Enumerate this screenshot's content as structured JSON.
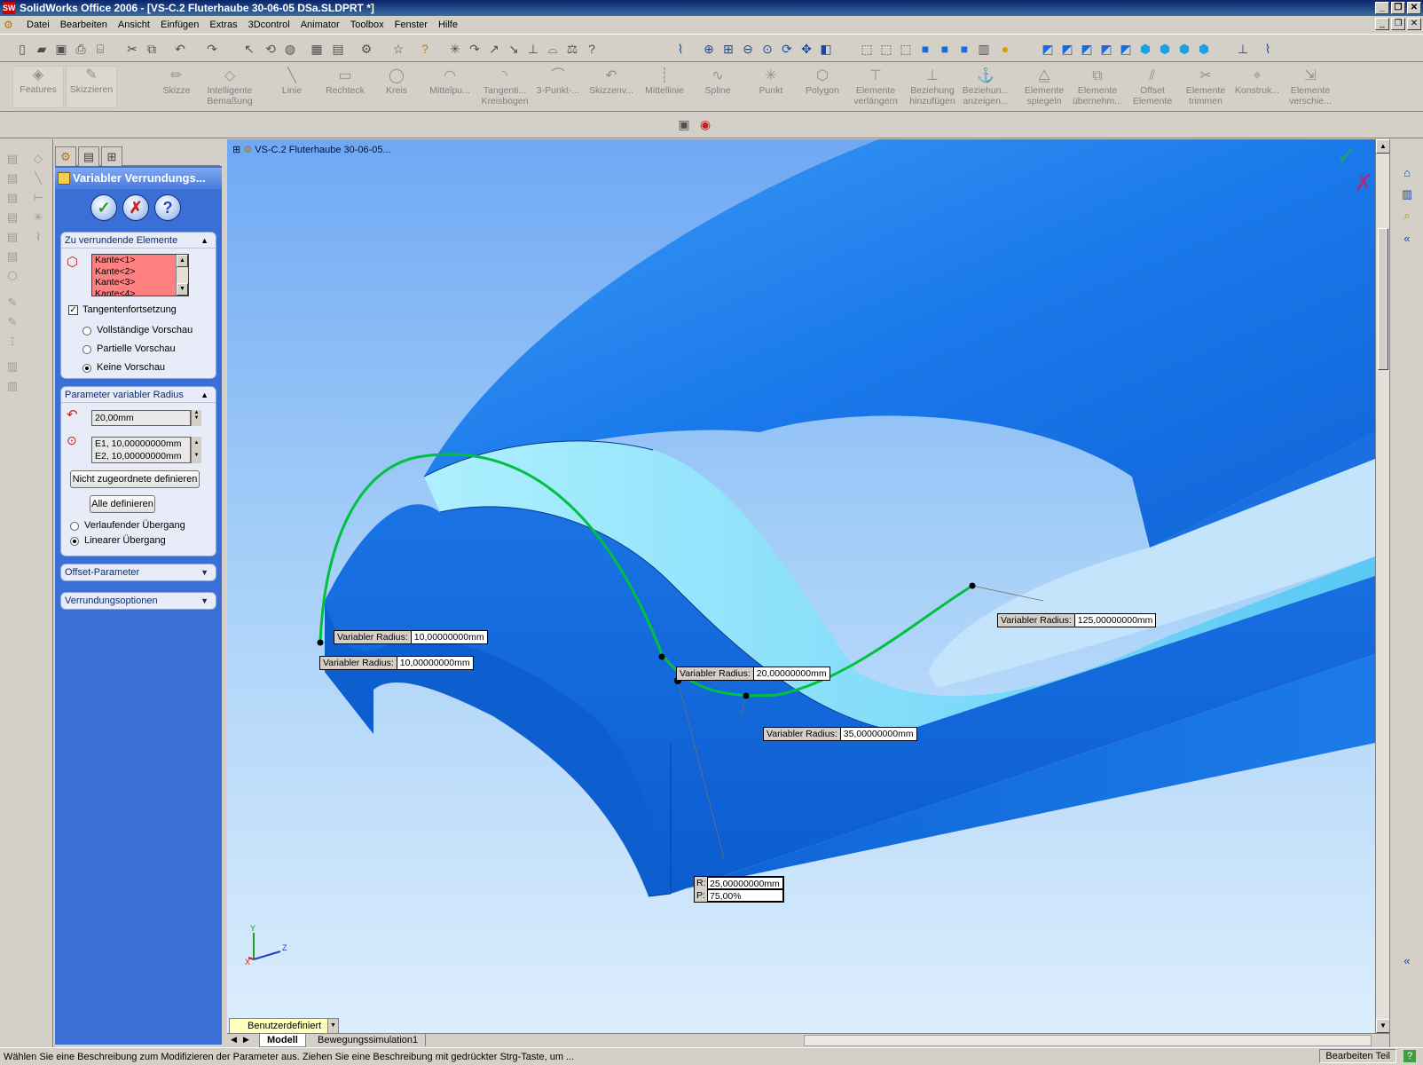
{
  "window": {
    "title": "SolidWorks Office 2006 - [VS-C.2 Fluterhaube 30-06-05 DSa.SLDPRT *]",
    "minimize": "_",
    "restore": "❐",
    "close": "✕"
  },
  "menu": {
    "items": [
      "Datei",
      "Bearbeiten",
      "Ansicht",
      "Einfügen",
      "Extras",
      "3Dcontrol",
      "Animator",
      "Toolbox",
      "Fenster",
      "Hilfe"
    ]
  },
  "commands": [
    {
      "label": "Features",
      "icon": "◈"
    },
    {
      "label": "Skizzieren",
      "icon": "✎"
    },
    {
      "label": "Skizze",
      "icon": "✏"
    },
    {
      "label": "Intelligente Bemaßung",
      "icon": "◇"
    },
    {
      "label": "Linie",
      "icon": "╲"
    },
    {
      "label": "Rechteck",
      "icon": "▭"
    },
    {
      "label": "Kreis",
      "icon": "◯"
    },
    {
      "label": "Mittelpu...",
      "icon": "◠"
    },
    {
      "label": "Tangenti... Kreisbogen",
      "icon": "◝"
    },
    {
      "label": "3-Punkt-...",
      "icon": "⌒"
    },
    {
      "label": "Skizzenv...",
      "icon": "↶"
    },
    {
      "label": "Mittellinie",
      "icon": "┊"
    },
    {
      "label": "Spline",
      "icon": "∿"
    },
    {
      "label": "Punkt",
      "icon": "✳"
    },
    {
      "label": "Polygon",
      "icon": "⬡"
    },
    {
      "label": "Elemente verlängern",
      "icon": "⊤"
    },
    {
      "label": "Beziehung hinzufügen",
      "icon": "⊥"
    },
    {
      "label": "Beziehun... anzeigen...",
      "icon": "⚓"
    },
    {
      "label": "Elemente spiegeln",
      "icon": "⧋"
    },
    {
      "label": "Elemente übernehm...",
      "icon": "⧉"
    },
    {
      "label": "Offset Elemente",
      "icon": "⫽"
    },
    {
      "label": "Elemente trimmen",
      "icon": "✂"
    },
    {
      "label": "Konstruk...",
      "icon": "⌖"
    },
    {
      "label": "Elemente verschie...",
      "icon": "⇲"
    }
  ],
  "property_manager": {
    "title": "Variabler Verrundungs...",
    "ok": "✓",
    "cancel": "✗",
    "help": "?",
    "group_elements": {
      "header": "Zu verrundende Elemente",
      "items": [
        "Kante<1>",
        "Kante<2>",
        "Kante<3>",
        "Kante<4>"
      ],
      "tangent_label": "Tangentenfortsetzung",
      "tangent_checked": true,
      "preview_options": [
        "Vollständige Vorschau",
        "Partielle Vorschau",
        "Keine Vorschau"
      ],
      "preview_selected": 2
    },
    "group_radius": {
      "header": "Parameter variabler Radius",
      "radius_value": "20,00mm",
      "vertices": [
        "E1, 10,00000000mm",
        "E2, 10,00000000mm"
      ],
      "btn_unassigned": "Nicht zugeordnete definieren",
      "btn_all": "Alle definieren",
      "transition_options": [
        "Verlaufender Übergang",
        "Linearer Übergang"
      ],
      "transition_selected": 1
    },
    "group_offset": {
      "header": "Offset-Parameter"
    },
    "group_options": {
      "header": "Verrundungsoptionen"
    }
  },
  "viewport": {
    "tree_root": "VS-C.2 Fluterhaube 30-06-05...",
    "callouts": [
      {
        "label": "Variabler Radius:",
        "value": "10,00000000mm"
      },
      {
        "label": "Variabler Radius:",
        "value": "10,00000000mm"
      },
      {
        "label": "Variabler Radius:",
        "value": "20,00000000mm"
      },
      {
        "label": "Variabler Radius:",
        "value": "35,00000000mm"
      },
      {
        "label": "Variabler Radius:",
        "value": "125,00000000mm"
      }
    ],
    "rp_callout": {
      "r_label": "R:",
      "r_value": "25,00000000mm",
      "p_label": "P:",
      "p_value": "75,00%"
    },
    "triad": {
      "x": "X",
      "y": "Y",
      "z": "Z"
    },
    "confirm_ok": "✓",
    "confirm_cancel": "✗"
  },
  "bottom": {
    "config": "Benutzerdefiniert",
    "tabs": [
      "Modell",
      "Bewegungssimulation1"
    ]
  },
  "status": {
    "message": "Wählen Sie eine Beschreibung zum Modifizieren der Parameter aus. Ziehen Sie eine Beschreibung mit gedrückter Strg-Taste, um ...",
    "mode": "Bearbeiten Teil",
    "help": "?"
  },
  "colors": {
    "model_blue": "#1670e8",
    "highlight_green": "#00c040",
    "selection_red": "#ff8080"
  }
}
